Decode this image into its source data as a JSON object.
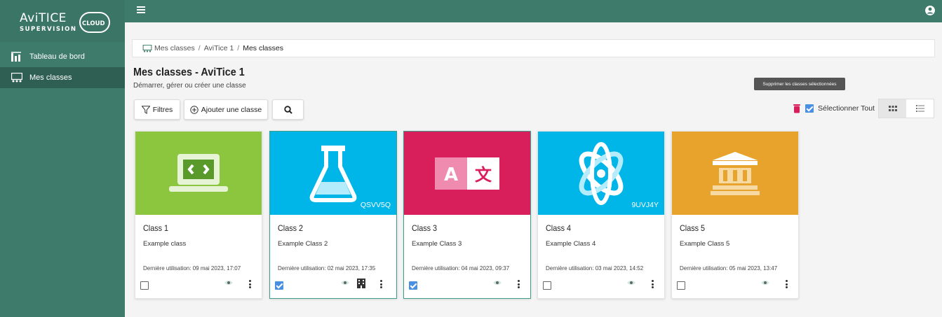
{
  "logo": {
    "brand": "AviTICE",
    "sub": "SUPERVISION",
    "badge": "CLOUD"
  },
  "sidebar": {
    "items": [
      {
        "label": "Tableau de bord",
        "icon": "dashboard-icon"
      },
      {
        "label": "Mes classes",
        "icon": "classes-icon",
        "active": true
      }
    ]
  },
  "breadcrumb": {
    "items": [
      "Mes classes",
      "AviTice 1",
      "Mes classes"
    ]
  },
  "page": {
    "title": "Mes classes - AviTice 1",
    "subtitle": "Démarrer, gérer ou créer une classe"
  },
  "toolbar": {
    "filters_label": "Filtres",
    "add_label": "Ajouter une classe",
    "tooltip": "Supprimer les classes sélectionnées",
    "select_all_label": "Sélectionner Tout"
  },
  "colors": {
    "brand": "#3e7b6b",
    "card1": "#8cc63f",
    "card2": "#00b5e8",
    "card3": "#d81e5b",
    "card4": "#00b5e8",
    "card5": "#e8a32c"
  },
  "cards": [
    {
      "name": "Class 1",
      "desc": "Example class",
      "date": "Dernière utilisation: 09 mai 2023, 17:07",
      "code": "",
      "icon": "laptop-code-icon",
      "selected": false
    },
    {
      "name": "Class 2",
      "desc": "Example Class 2",
      "date": "Dernière utilisation: 02 mai 2023, 17:35",
      "code": "QSVV5Q",
      "icon": "flask-icon",
      "selected": true
    },
    {
      "name": "Class 3",
      "desc": "Example Class 3",
      "date": "Dernière utilisation: 04 mai 2023, 09:37",
      "code": "",
      "icon": "translate-icon",
      "selected": true
    },
    {
      "name": "Class 4",
      "desc": "Example Class 4",
      "date": "Dernière utilisation: 03 mai 2023, 14:52",
      "code": "9UVJ4Y",
      "icon": "atom-icon",
      "selected": false
    },
    {
      "name": "Class 5",
      "desc": "Example Class 5",
      "date": "Dernière utilisation: 05 mai 2023, 13:47",
      "code": "",
      "icon": "museum-icon",
      "selected": false
    }
  ]
}
